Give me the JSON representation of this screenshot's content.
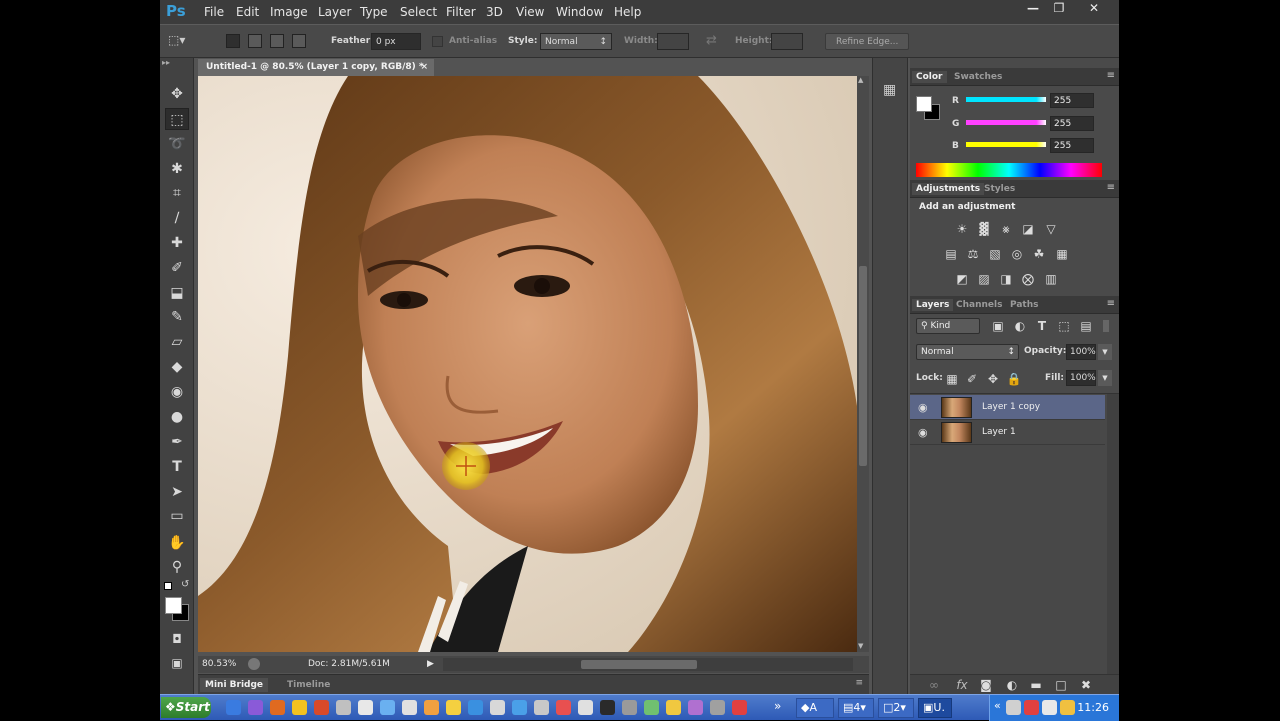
{
  "app": {
    "logo": "Ps",
    "menu": [
      "File",
      "Edit",
      "Image",
      "Layer",
      "Type",
      "Select",
      "Filter",
      "3D",
      "View",
      "Window",
      "Help"
    ],
    "window_buttons": [
      "—",
      "❐",
      "✕"
    ]
  },
  "options": {
    "feather_label": "Feather:",
    "feather_value": "0 px",
    "antialias_label": "Anti-alias",
    "style_label": "Style:",
    "style_value": "Normal",
    "width_label": "Width:",
    "height_label": "Height:",
    "refine_label": "Refine Edge..."
  },
  "document": {
    "tab_title": "Untitled-1 @ 80.5% (Layer 1 copy, RGB/8) *",
    "tab_close": "×",
    "zoom": "80.53%",
    "doc_size": "Doc: 2.81M/5.61M"
  },
  "bottom_tabs": [
    "Mini Bridge",
    "Timeline"
  ],
  "color_panel": {
    "tabs": [
      "Color",
      "Swatches"
    ],
    "channels": [
      {
        "label": "R",
        "value": "255",
        "gradient": "#00e5ff"
      },
      {
        "label": "G",
        "value": "255",
        "gradient": "#ff40ff"
      },
      {
        "label": "B",
        "value": "255",
        "gradient": "#ffff00"
      }
    ]
  },
  "adjustments_panel": {
    "tabs": [
      "Adjustments",
      "Styles"
    ],
    "heading": "Add an adjustment"
  },
  "layers_panel": {
    "tabs": [
      "Layers",
      "Channels",
      "Paths"
    ],
    "kind_label": "Kind",
    "blend_mode": "Normal",
    "opacity_label": "Opacity:",
    "opacity_value": "100%",
    "lock_label": "Lock:",
    "fill_label": "Fill:",
    "fill_value": "100%",
    "layers": [
      {
        "name": "Layer 1 copy",
        "selected": true
      },
      {
        "name": "Layer 1",
        "selected": false
      }
    ]
  },
  "taskbar": {
    "start_label": "Start",
    "task_labels": [
      "A",
      "4",
      "2",
      "U."
    ],
    "clock": "11:26"
  }
}
